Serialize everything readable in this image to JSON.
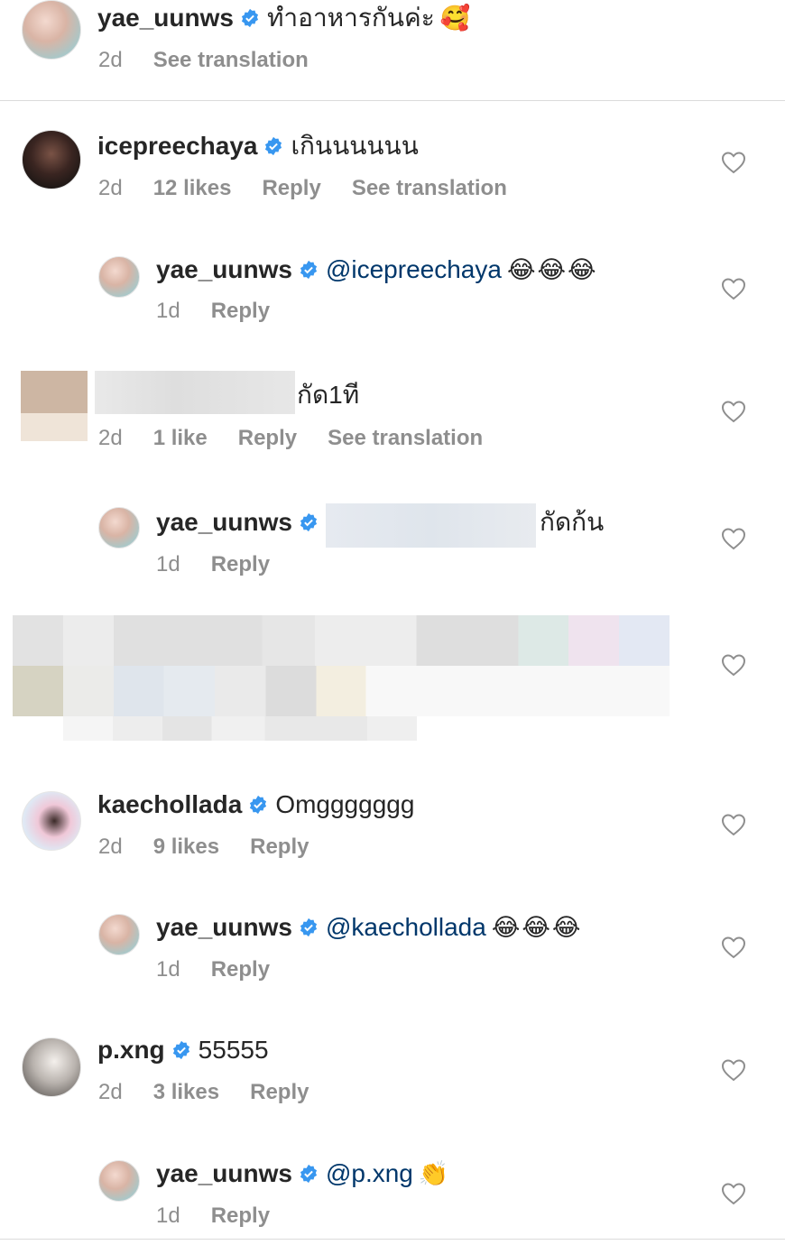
{
  "comments": [
    {
      "username": "yae_uunws",
      "text": "ทำอาหารกันค่ะ",
      "emoji": "🥰",
      "time": "2d",
      "translate": "See translation"
    },
    {
      "username": "icepreechaya",
      "text": "เกินนนนนน",
      "time": "2d",
      "likes": "12 likes",
      "reply": "Reply",
      "translate": "See translation"
    },
    {
      "username": "yae_uunws",
      "mention": "@icepreechaya",
      "emoji": "😂😂😂",
      "time": "1d",
      "reply": "Reply"
    },
    {
      "text": "กัด1ที",
      "time": "2d",
      "likes": "1 like",
      "reply": "Reply",
      "translate": "See translation"
    },
    {
      "username": "yae_uunws",
      "text": "กัดก้น",
      "time": "1d",
      "reply": "Reply"
    },
    {
      "username": "kaechollada",
      "text": "Omggggggg",
      "time": "2d",
      "likes": "9 likes",
      "reply": "Reply"
    },
    {
      "username": "yae_uunws",
      "mention": "@kaechollada",
      "emoji": "😂😂😂",
      "time": "1d",
      "reply": "Reply"
    },
    {
      "username": "p.xng",
      "text": "55555",
      "time": "2d",
      "likes": "3 likes",
      "reply": "Reply"
    },
    {
      "username": "yae_uunws",
      "mention": "@p.xng",
      "emoji": "👏",
      "time": "1d",
      "reply": "Reply"
    }
  ],
  "colors": {
    "verified": "#3897f0",
    "meta": "#8e8e8e",
    "mention": "#00376b"
  },
  "icons": {
    "verified": "verified-badge-icon",
    "like": "heart-outline-icon"
  }
}
